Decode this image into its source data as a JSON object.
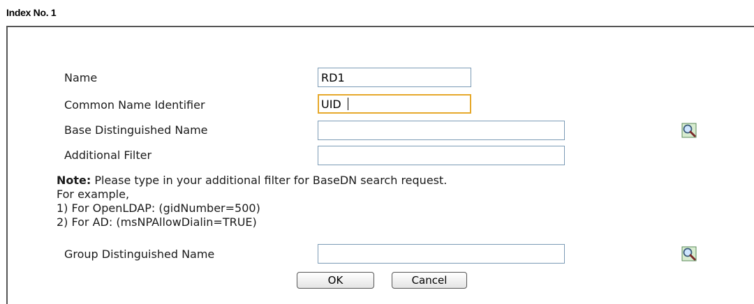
{
  "index_title": "Index No. 1",
  "fields": {
    "name": {
      "label": "Name",
      "value": "RD1"
    },
    "common_name": {
      "label": "Common Name Identifier",
      "value": "UID"
    },
    "base_dn": {
      "label": "Base Distinguished Name",
      "value": ""
    },
    "additional_filter": {
      "label": "Additional Filter",
      "value": ""
    },
    "group_dn": {
      "label": "Group Distinguished Name",
      "value": ""
    }
  },
  "note": {
    "prefix": "Note:",
    "text": " Please type in your additional filter for BaseDN search request.",
    "line2": "For example,",
    "line3": "1) For OpenLDAP: (gidNumber=500)",
    "line4": "2) For AD: (msNPAllowDialin=TRUE)"
  },
  "buttons": {
    "ok": "OK",
    "cancel": "Cancel"
  },
  "icons": {
    "search": "magnifier-search-icon"
  },
  "colors": {
    "input_border": "#7a9ab5",
    "focus_border": "#e6a82a"
  }
}
